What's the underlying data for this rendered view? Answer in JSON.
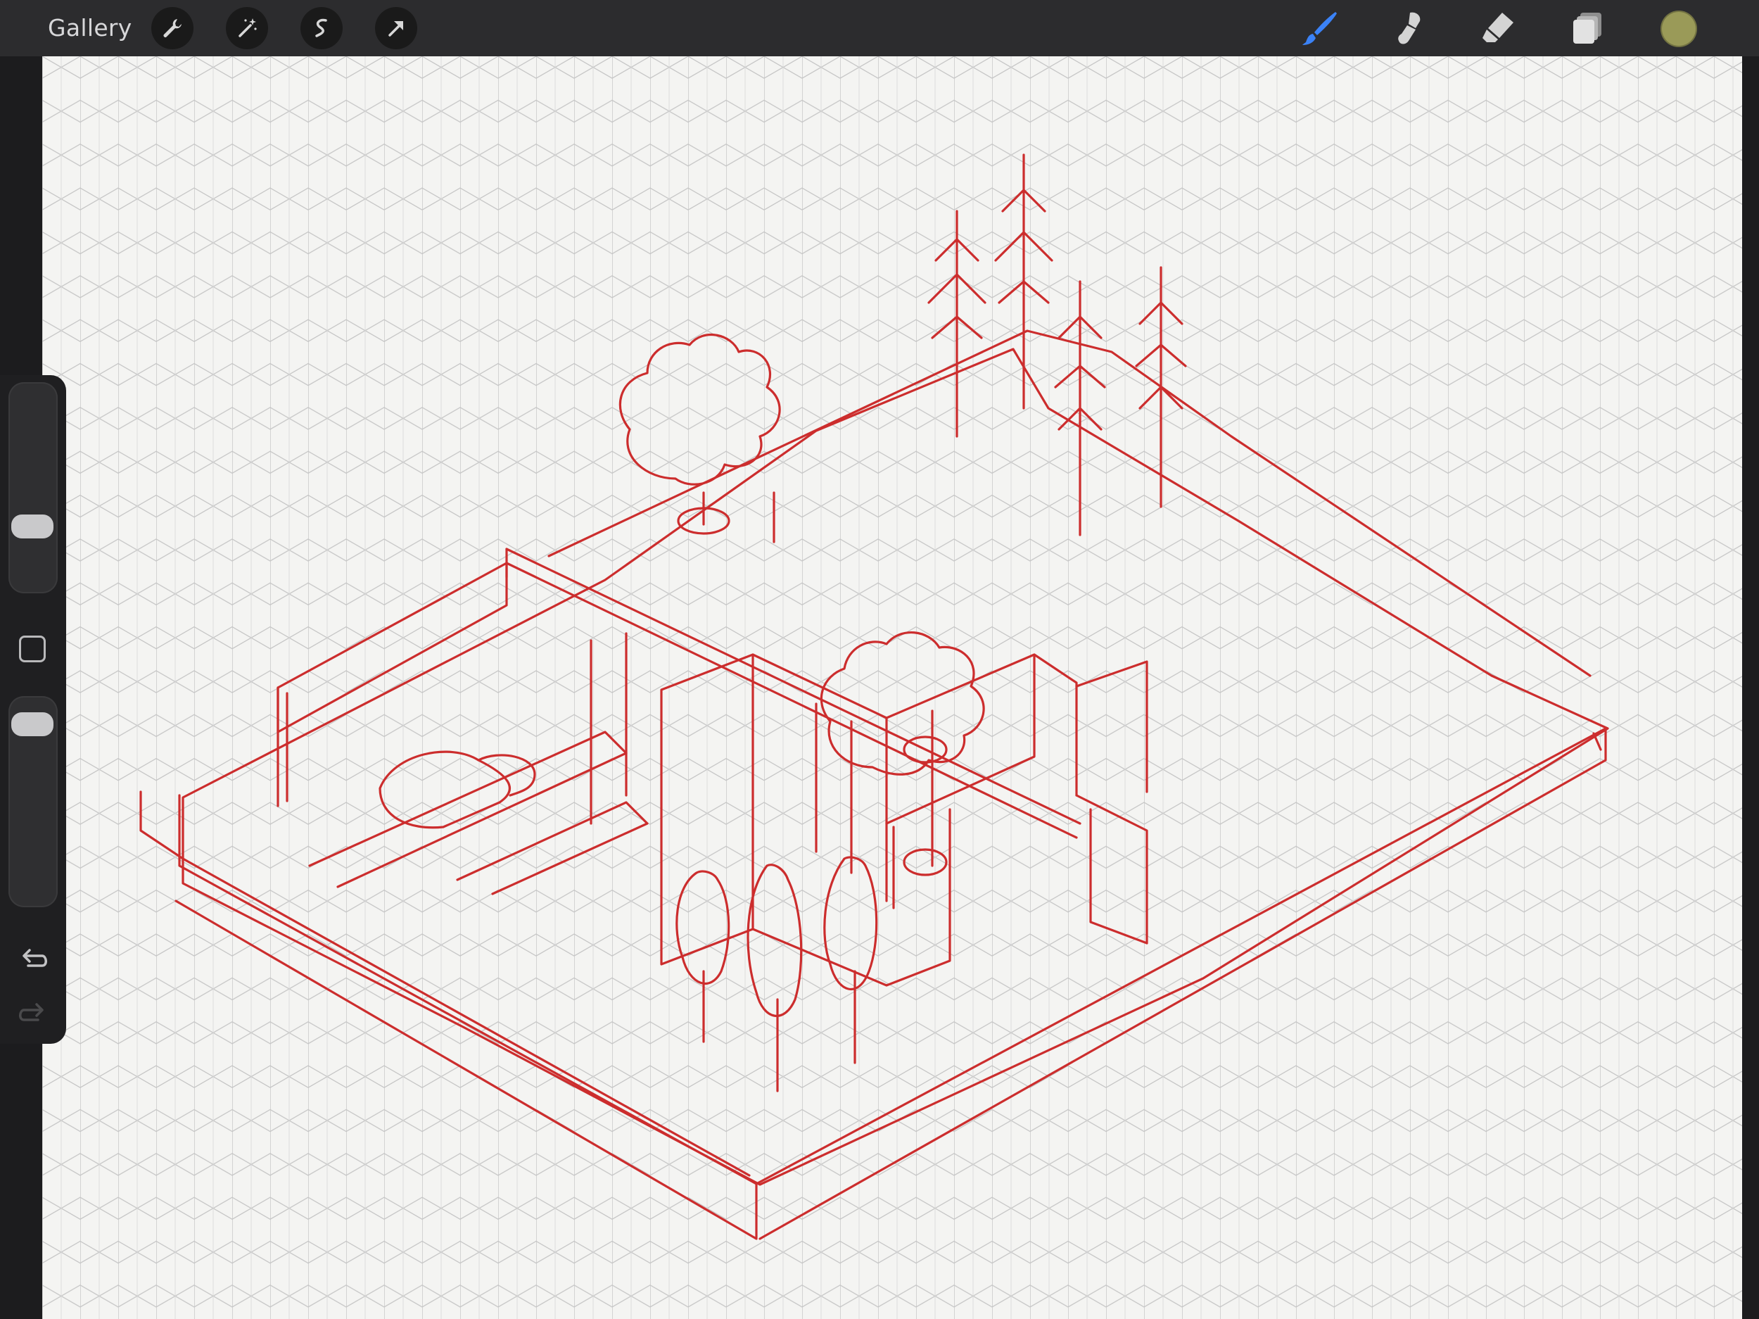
{
  "app": {
    "gallery_label": "Gallery"
  },
  "toolbar": {
    "left_tools": [
      "wrench-icon",
      "magic-wand-icon",
      "selection-icon",
      "transform-arrow-icon"
    ],
    "right_tools": [
      "brush-icon",
      "smudge-icon",
      "eraser-icon",
      "layers-icon"
    ],
    "active_tool": "brush-icon",
    "current_color": "#9a9a58"
  },
  "sidebar": {
    "brush_size_level": 0.28,
    "opacity_level": 0.94,
    "controls": [
      "brush-size-slider",
      "modify-button",
      "opacity-slider",
      "undo-icon",
      "redo-icon"
    ]
  },
  "canvas": {
    "background": "#f4f4f2",
    "grid": "isometric",
    "grid_color": "#c8c8c8",
    "ink_color": "#cc2d2d"
  }
}
